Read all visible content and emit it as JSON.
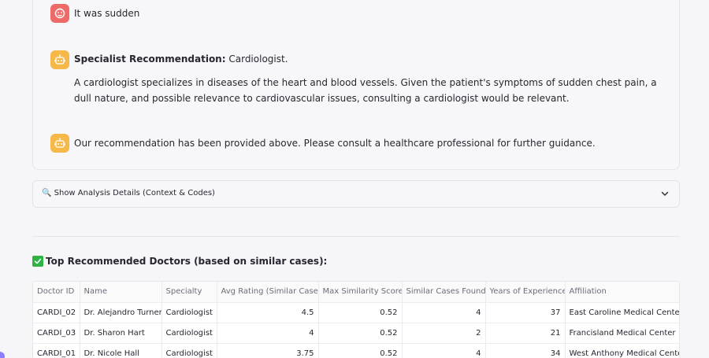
{
  "chat": {
    "user_message": "It was sudden",
    "specialist": {
      "label": "Specialist Recommendation:",
      "value": "Cardiologist.",
      "explanation": "A cardiologist specializes in diseases of the heart and blood vessels. Given the patient's symptoms of sudden chest pain, a dull nature, and possible relevance to cardiovascular issues, consulting a cardiologist would be relevant."
    },
    "final_message": "Our recommendation has been provided above. Please consult a healthcare professional for further guidance."
  },
  "expander": {
    "label": "🔍 Show Analysis Details (Context & Codes)",
    "icon": "chevron-down-icon"
  },
  "section": {
    "title": "Top Recommended Doctors (based on similar cases):",
    "icon": "check-icon"
  },
  "table": {
    "columns": [
      "Doctor ID",
      "Name",
      "Specialty",
      "Avg Rating (Similar Cases)",
      "Max Similarity Score",
      "Similar Cases Found",
      "Years of Experience",
      "Affiliation"
    ],
    "rows": [
      [
        "CARDI_02",
        "Dr. Alejandro Turner",
        "Cardiologist",
        "4.5",
        "0.52",
        "4",
        "37",
        "East Caroline Medical Center"
      ],
      [
        "CARDI_03",
        "Dr. Sharon Hart",
        "Cardiologist",
        "4",
        "0.52",
        "2",
        "21",
        "Francisland Medical Center"
      ],
      [
        "CARDI_01",
        "Dr. Nicole Hall",
        "Cardiologist",
        "3.75",
        "0.52",
        "4",
        "34",
        "West Anthony Medical Center"
      ]
    ]
  },
  "colors": {
    "user_avatar": "#ee6a68",
    "bot_avatar": "#f7b84a",
    "check": "#2fb344"
  }
}
